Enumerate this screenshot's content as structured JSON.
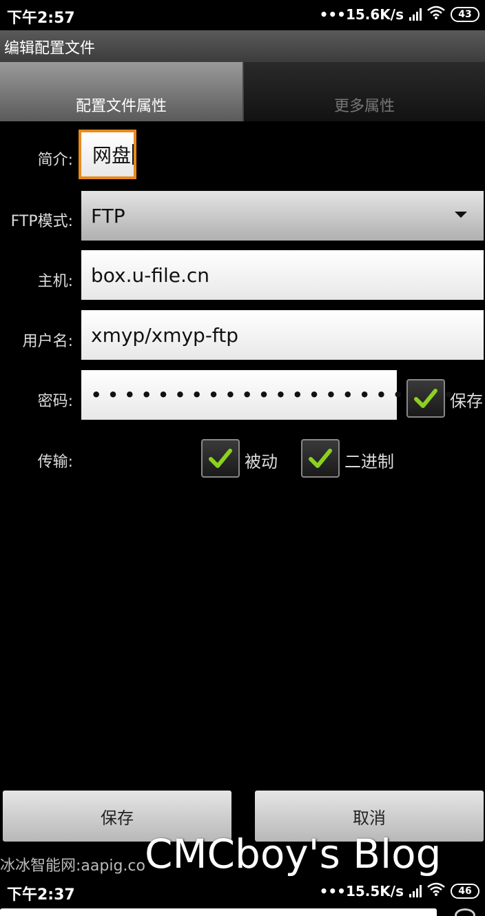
{
  "status_bar": {
    "time": "下午2:57",
    "speed": "15.6K/s",
    "battery": "43"
  },
  "status_bar_2": {
    "time": "下午2:37",
    "speed": "15.5K/s",
    "battery": "46"
  },
  "title": "编辑配置文件",
  "tabs": {
    "active": "配置文件属性",
    "inactive": "更多属性"
  },
  "form": {
    "description_label": "简介:",
    "description_value": "网盘",
    "ftp_mode_label": "FTP模式:",
    "ftp_mode_value": "FTP",
    "host_label": "主机:",
    "host_value": "box.u-file.cn",
    "username_label": "用户名:",
    "username_value": "xmyp/xmyp-ftp",
    "password_label": "密码:",
    "password_mask": "••••••••••••••••••••••",
    "save_password_label": "保存",
    "transfer_label": "传输:",
    "passive_label": "被动",
    "binary_label": "二进制"
  },
  "buttons": {
    "save": "保存",
    "cancel": "取消"
  },
  "site_text": "冰冰智能网:aapig.co",
  "watermark": "CMCboy's Blog",
  "colors": {
    "focus": "#e88a1a",
    "check": "#8bd11f"
  }
}
